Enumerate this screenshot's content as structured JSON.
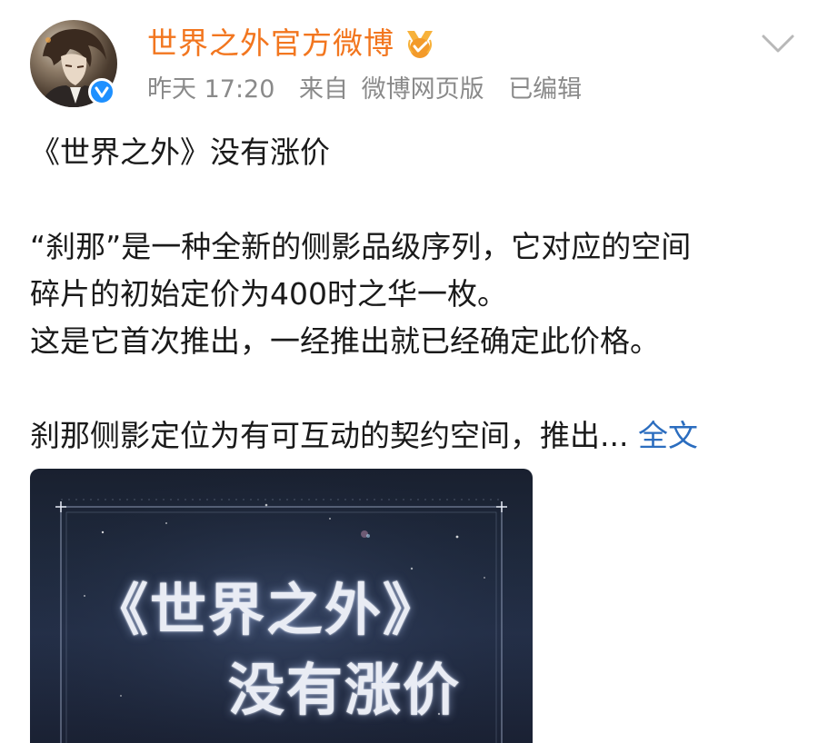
{
  "author": {
    "name": "世界之外官方微博",
    "avatar_icon": "character-portrait-avatar",
    "verified_icon": "blue-verified-v-icon",
    "vip_icon": "orange-vip-medal-icon",
    "name_color": "#f2761f"
  },
  "meta": {
    "time": "昨天 17:20",
    "source_prefix": "来自",
    "source": "微博网页版",
    "edited": "已编辑"
  },
  "post": {
    "title": "《世界之外》没有涨价",
    "paragraph1_line1": "“刹那”是一种全新的侧影品级序列，它对应的空间",
    "paragraph1_line2": "碎片的初始定价为400时之华一枚。",
    "paragraph1_line3": "这是它首次推出，一经推出就已经确定此价格。",
    "paragraph2": "刹那侧影定位为有可互动的契约空间，推出...",
    "full_text_link": "全文",
    "link_color": "#2b6dbf"
  },
  "image": {
    "title_line1": "《世界之外》",
    "title_line2": "没有涨价"
  },
  "dropdown_icon": "chevron-down-icon"
}
